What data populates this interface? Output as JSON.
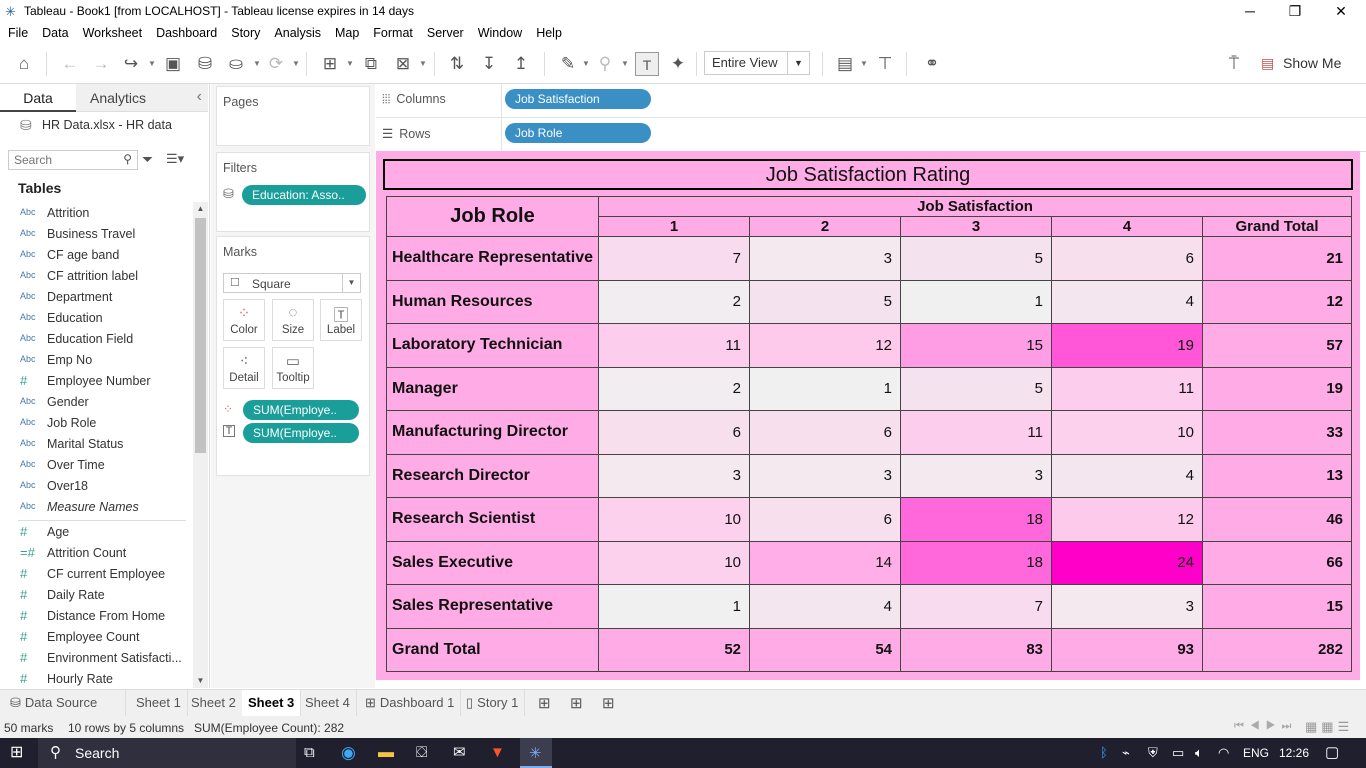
{
  "window": {
    "title": "Tableau - Book1 [from LOCALHOST] - Tableau license expires in 14 days",
    "minimize": "─",
    "restore": "❐",
    "close": "✕"
  },
  "menu": [
    "File",
    "Data",
    "Worksheet",
    "Dashboard",
    "Story",
    "Analysis",
    "Map",
    "Format",
    "Server",
    "Window",
    "Help"
  ],
  "toolbar": {
    "fit_value": "Entire View",
    "show_me": "Show Me"
  },
  "datapane": {
    "tab_data": "Data",
    "tab_analytics": "Analytics",
    "datasource": "HR Data.xlsx - HR data",
    "search_placeholder": "Search",
    "tables_label": "Tables",
    "dimensions": [
      {
        "type": "Abc",
        "name": "Attrition"
      },
      {
        "type": "Abc",
        "name": "Business Travel"
      },
      {
        "type": "Abc",
        "name": "CF age band"
      },
      {
        "type": "Abc",
        "name": "CF attrition label"
      },
      {
        "type": "Abc",
        "name": "Department"
      },
      {
        "type": "Abc",
        "name": "Education"
      },
      {
        "type": "Abc",
        "name": "Education Field"
      },
      {
        "type": "Abc",
        "name": "Emp No"
      },
      {
        "type": "#",
        "name": "Employee Number"
      },
      {
        "type": "Abc",
        "name": "Gender"
      },
      {
        "type": "Abc",
        "name": "Job Role"
      },
      {
        "type": "Abc",
        "name": "Marital Status"
      },
      {
        "type": "Abc",
        "name": "Over Time"
      },
      {
        "type": "Abc",
        "name": "Over18"
      },
      {
        "type": "Abc",
        "name": "Measure Names"
      }
    ],
    "measures": [
      {
        "type": "#",
        "name": "Age"
      },
      {
        "type": "=#",
        "name": "Attrition Count"
      },
      {
        "type": "#",
        "name": "CF current Employee"
      },
      {
        "type": "#",
        "name": "Daily Rate"
      },
      {
        "type": "#",
        "name": "Distance From Home"
      },
      {
        "type": "#",
        "name": "Employee Count"
      },
      {
        "type": "#",
        "name": "Environment Satisfacti..."
      },
      {
        "type": "#",
        "name": "Hourly Rate"
      }
    ]
  },
  "shelves": {
    "pages": "Pages",
    "filters": "Filters",
    "filter_pill": "Education: Asso..",
    "marks": "Marks",
    "mark_type": "Square",
    "mark_buttons": [
      "Color",
      "Size",
      "Label",
      "Detail",
      "Tooltip"
    ],
    "mark_pills": [
      "SUM(Employe..",
      "SUM(Employe.."
    ],
    "columns_label": "Columns",
    "columns_pill": "Job Satisfaction",
    "rows_label": "Rows",
    "rows_pill": "Job Role"
  },
  "view": {
    "title": "Job Satisfaction Rating",
    "row_header": "Job Role",
    "col_group_header": "Job Satisfaction",
    "columns": [
      "1",
      "2",
      "3",
      "4",
      "Grand Total"
    ],
    "colors": {
      "low": "#f0f0f0",
      "high": "#ff00c8",
      "total_bg": "#ffabe6"
    },
    "rows": [
      {
        "label": "Healthcare Representative",
        "values": [
          7,
          3,
          5,
          6
        ],
        "total": 21
      },
      {
        "label": "Human Resources",
        "values": [
          2,
          5,
          1,
          4
        ],
        "total": 12
      },
      {
        "label": "Laboratory Technician",
        "values": [
          11,
          12,
          15,
          19
        ],
        "total": 57
      },
      {
        "label": "Manager",
        "values": [
          2,
          1,
          5,
          11
        ],
        "total": 19
      },
      {
        "label": "Manufacturing Director",
        "values": [
          6,
          6,
          11,
          10
        ],
        "total": 33
      },
      {
        "label": "Research Director",
        "values": [
          3,
          3,
          3,
          4
        ],
        "total": 13
      },
      {
        "label": "Research Scientist",
        "values": [
          10,
          6,
          18,
          12
        ],
        "total": 46
      },
      {
        "label": "Sales Executive",
        "values": [
          10,
          14,
          18,
          24
        ],
        "total": 66
      },
      {
        "label": "Sales Representative",
        "values": [
          1,
          4,
          7,
          3
        ],
        "total": 15
      }
    ],
    "grand_total": {
      "label": "Grand Total",
      "values": [
        52,
        54,
        83,
        93
      ],
      "total": 282
    }
  },
  "tabs": [
    "Data Source",
    "Sheet 1",
    "Sheet 2",
    "Sheet 3",
    "Sheet 4",
    "Dashboard 1",
    "Story 1"
  ],
  "active_tab": "Sheet 3",
  "status": {
    "marks": "50 marks",
    "dims": "10 rows by 5 columns",
    "sum": "SUM(Employee Count): 282"
  },
  "taskbar": {
    "search": "Search",
    "lang": "ENG",
    "time": "12:26"
  }
}
